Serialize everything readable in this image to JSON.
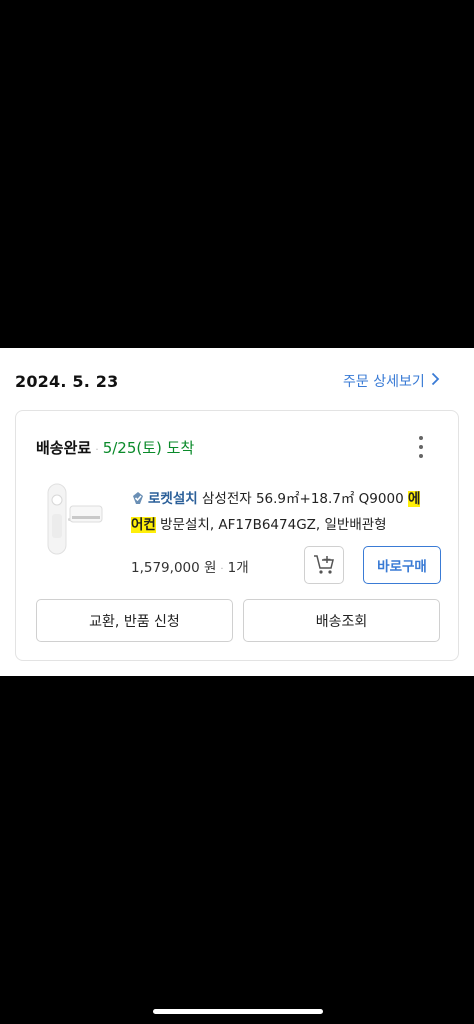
{
  "order": {
    "date": "2024. 5. 23",
    "detail_link": "주문 상세보기",
    "status": "배송완료",
    "separator": "·",
    "arrival": "5/25(토) 도착",
    "badge": "로켓설치",
    "title_after_badge": "삼성전자 56.9㎡+18.7㎡ Q9000",
    "highlight": "에어컨",
    "title_rest": "방문설치, AF17B6474GZ, 일반배관형",
    "price": "1,579,000 원",
    "quantity": "1개",
    "buy_now": "바로구매",
    "exchange_return": "교환, 반품 신청",
    "track_delivery": "배송조회"
  },
  "colors": {
    "accent": "#3a7bd5",
    "arrival_green": "#0a8a2a",
    "highlight_yellow": "#ffef0a"
  },
  "icons": {
    "more": "more-vertical-icon",
    "chevron": "chevron-right-icon",
    "cart": "add-to-cart-icon",
    "rocket": "rocket-install-icon"
  }
}
